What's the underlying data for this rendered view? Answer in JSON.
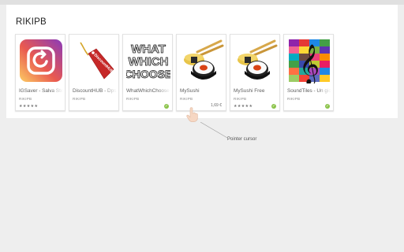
{
  "section": {
    "title": "RIKIPB"
  },
  "apps": [
    {
      "title": "IGSaver - Salva Storie",
      "developer": "RIKIPB",
      "stars": "★★★★★",
      "price": "",
      "installed": false,
      "icon": "instagram-saver-icon"
    },
    {
      "title": "DiscountHUB - Dps",
      "developer": "RIKIPB",
      "stars": "",
      "price": "",
      "installed": false,
      "icon": "discount-tag-icon",
      "tag_text": "DiscountHUB"
    },
    {
      "title": "WhatWhichChoose",
      "developer": "RIKIPB",
      "stars": "",
      "price": "",
      "installed": true,
      "icon": "what-which-choose-logo",
      "logo_lines": [
        "WHAT",
        "WHICH",
        "CHOOSE"
      ]
    },
    {
      "title": "MySushi",
      "developer": "RIKIPB",
      "stars": "",
      "price": "1,69 €",
      "installed": false,
      "icon": "sushi-icon"
    },
    {
      "title": "MySushi Free",
      "developer": "RIKIPB",
      "stars": "★★★★★",
      "price": "",
      "installed": true,
      "icon": "sushi-icon"
    },
    {
      "title": "SoundTiles - Un gioco",
      "developer": "RIKIPB",
      "stars": "",
      "price": "",
      "installed": true,
      "icon": "treble-clef-tiles-icon"
    }
  ],
  "annotation": {
    "label": "Pointer cursor"
  },
  "colors": {
    "installed_badge": "#8bc34a",
    "ig_gradient": [
      "#8a3ab9",
      "#e95950",
      "#fccc63"
    ],
    "tag_red": "#c62828",
    "sushi_rice": "#e8c54a"
  }
}
